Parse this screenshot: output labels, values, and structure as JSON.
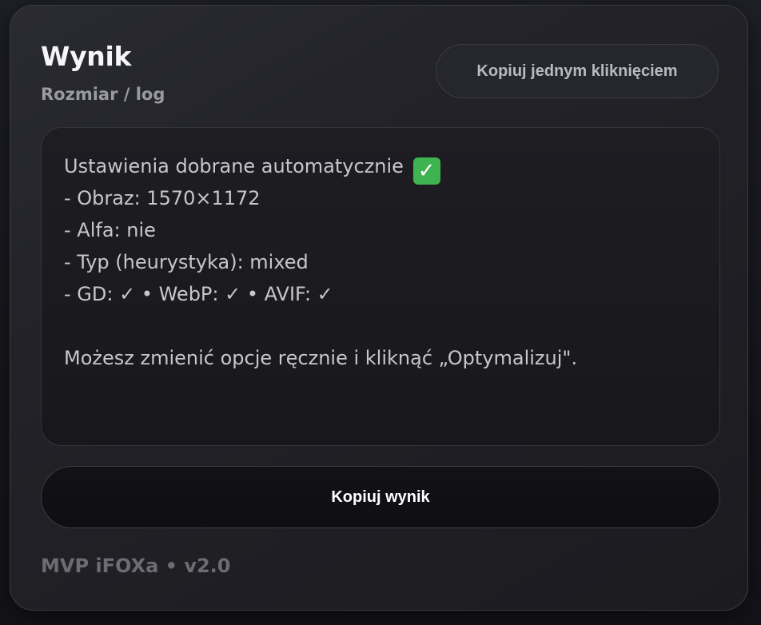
{
  "card": {
    "title": "Wynik",
    "subtitle": "Rozmiar / log",
    "copy_one_click_label": "Kopiuj jednym kliknięciem"
  },
  "output": {
    "lines": [
      "Ustawienia dobrane automatycznie",
      "- Obraz: 1570×1172",
      "- Alfa: nie",
      "- Typ (heurystyka): mixed",
      "- GD: ✓ • WebP: ✓ • AVIF: ✓",
      "",
      "Możesz zmienić opcje ręcznie i kliknąć „Optymalizuj\"."
    ],
    "status_emoji": "✓"
  },
  "copy_result_label": "Kopiuj wynik",
  "footer": "MVP iFOXa • v2.0"
}
